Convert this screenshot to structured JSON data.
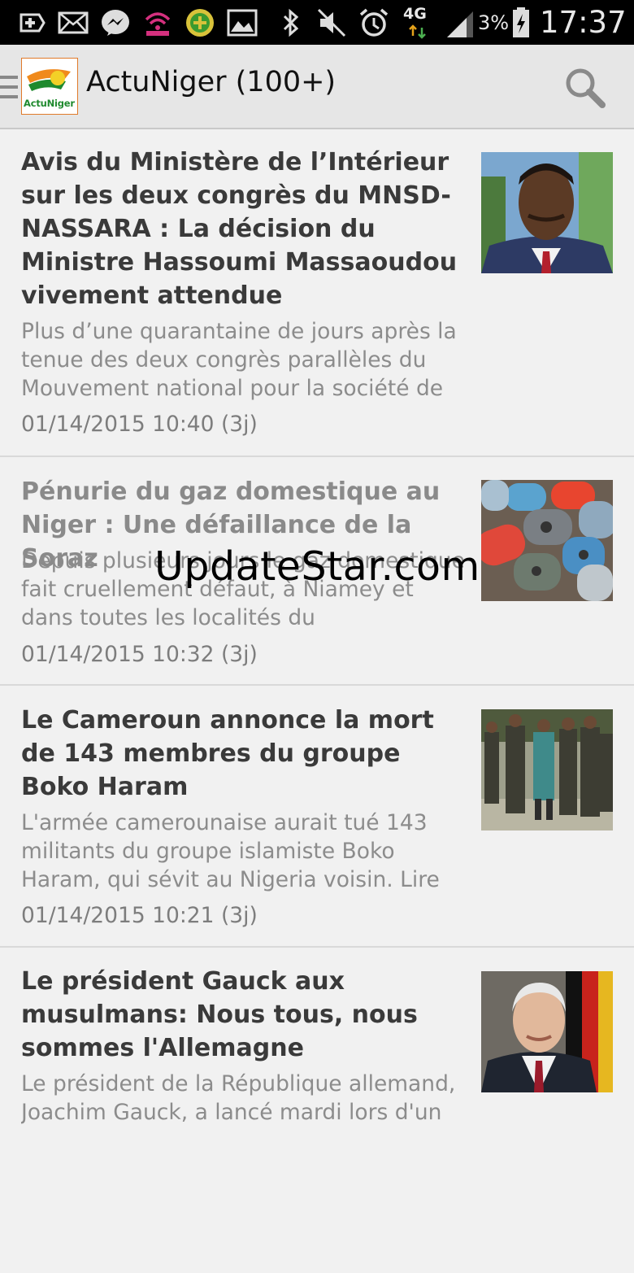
{
  "status_bar": {
    "battery_percent": "3%",
    "time": "17:37",
    "network": "4G",
    "icons": [
      "add-icon",
      "mail-icon",
      "messenger-icon",
      "signal-broadcast-icon",
      "app-badge-icon",
      "gallery-icon",
      "bluetooth-icon",
      "mute-icon",
      "alarm-icon",
      "network-4g-icon",
      "cell-signal-icon",
      "battery-charging-icon"
    ]
  },
  "app_bar": {
    "title": "ActuNiger (100+)",
    "logo_text": "ActuNiger",
    "logo_colors": {
      "green": "#1f8a2e",
      "orange": "#f08a1c",
      "border": "#e07a2a"
    }
  },
  "feed": {
    "items": [
      {
        "headline": "Avis du Ministère de l’Intérieur sur les deux congrès du MNSD-NASSARA : La décision du Ministre Hassoumi Massaoudou vivement attendue",
        "summary": "Plus d’une quarantaine de jours après la tenue des deux congrès parallèles du Mouvement national pour la société de",
        "date": "01/14/2015 10:40 (3j)",
        "thumbnail": "portrait-man-photo",
        "read": false
      },
      {
        "headline": "Pénurie du gaz domestique au Niger : Une défaillance de la Soraz",
        "summary": "Depuis plusieurs jours le gaz domestique fait cruellement défaut, à Niamey et dans toutes les localités du",
        "date": "01/14/2015 10:32 (3j)",
        "thumbnail": "gas-cylinders-photo",
        "read": true
      },
      {
        "headline": "Le Cameroun annonce la mort de 143 membres du groupe Boko Haram",
        "summary": "L'armée camerounaise aurait tué 143 militants du groupe islamiste Boko Haram, qui sévit au Nigeria voisin. Lire",
        "date": "01/14/2015 10:21 (3j)",
        "thumbnail": "soldiers-photo",
        "read": false
      },
      {
        "headline": "Le président Gauck aux musulmans: Nous tous, nous sommes l'Allemagne",
        "summary": "Le président de la République allemand, Joachim Gauck, a lancé mardi lors d'un",
        "date": "",
        "thumbnail": "president-portrait-photo",
        "read": false
      }
    ]
  },
  "watermark": "UpdateStar.com"
}
